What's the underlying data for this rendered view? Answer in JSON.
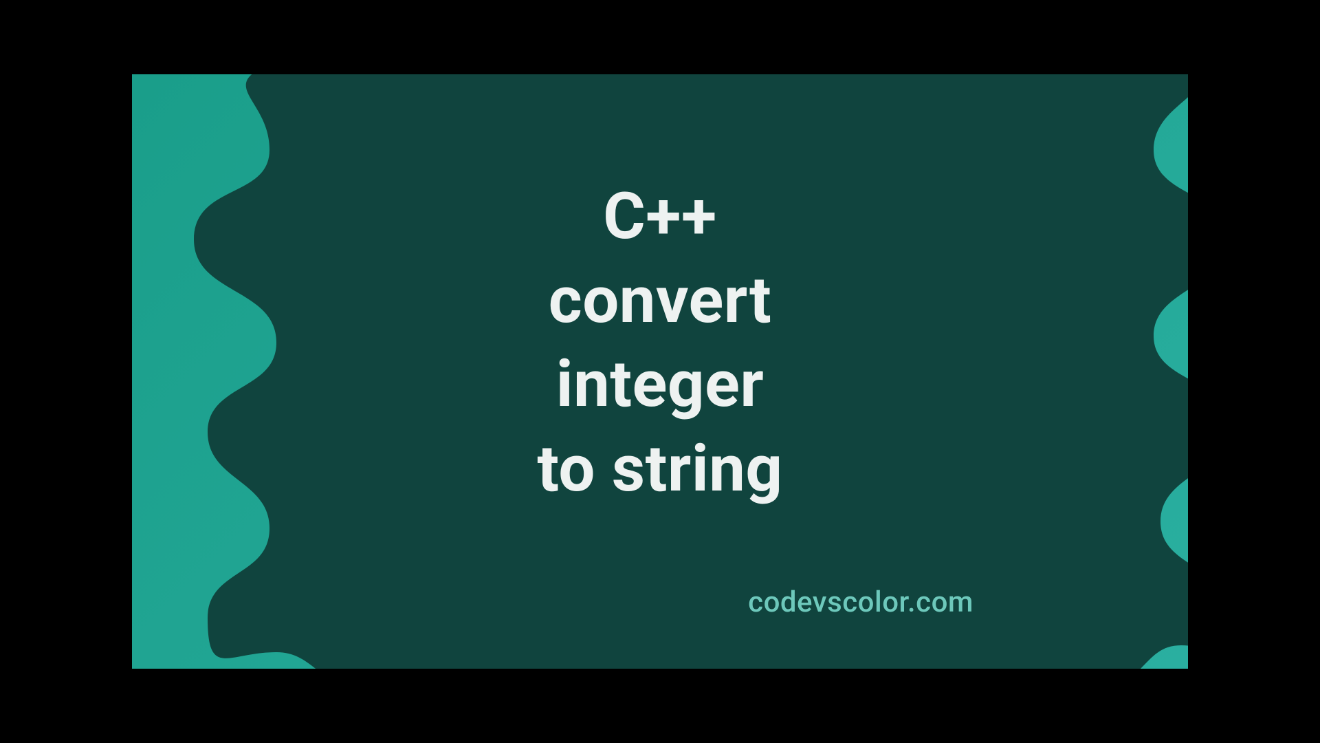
{
  "title": "C++\nconvert\ninteger\nto string",
  "site": "codevscolor.com",
  "colors": {
    "bg_start": "#1a9e8a",
    "bg_end": "#2aafa0",
    "blob": "#10443e",
    "title_text": "#eef2f1",
    "site_text": "#6dc8bb"
  }
}
